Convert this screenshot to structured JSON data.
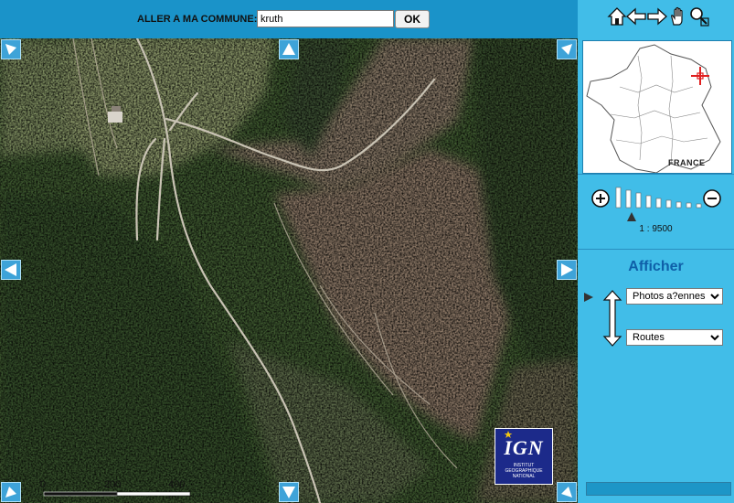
{
  "topbar": {
    "commune_label": "ALLER A MA COMMUNE:",
    "commune_value": "kruth",
    "ok_label": "OK"
  },
  "map": {
    "scale": {
      "labels": [
        "0",
        "200",
        "400 m"
      ]
    },
    "logo": {
      "text": "IGN",
      "subtitle_lines": [
        "INSTITUT",
        "GEOGRAPHIQUE",
        "NATIONAL"
      ]
    }
  },
  "panel": {
    "tools": [
      "home-icon",
      "arrow-left-icon",
      "arrow-right-icon",
      "hand-pan-icon",
      "magnifier-icon"
    ],
    "minimap": {
      "country_label": "FRANCE"
    },
    "zoom": {
      "scale_text": "1 : 9500",
      "level_count": 9,
      "current_level": 1
    },
    "afficher": {
      "title": "Afficher",
      "layer1": "Photos a?ennes",
      "layer2": "Routes"
    }
  },
  "colors": {
    "panel_bg": "#41bde8",
    "topbar_bg": "#1a93c9",
    "title_blue": "#0e5fa8"
  }
}
